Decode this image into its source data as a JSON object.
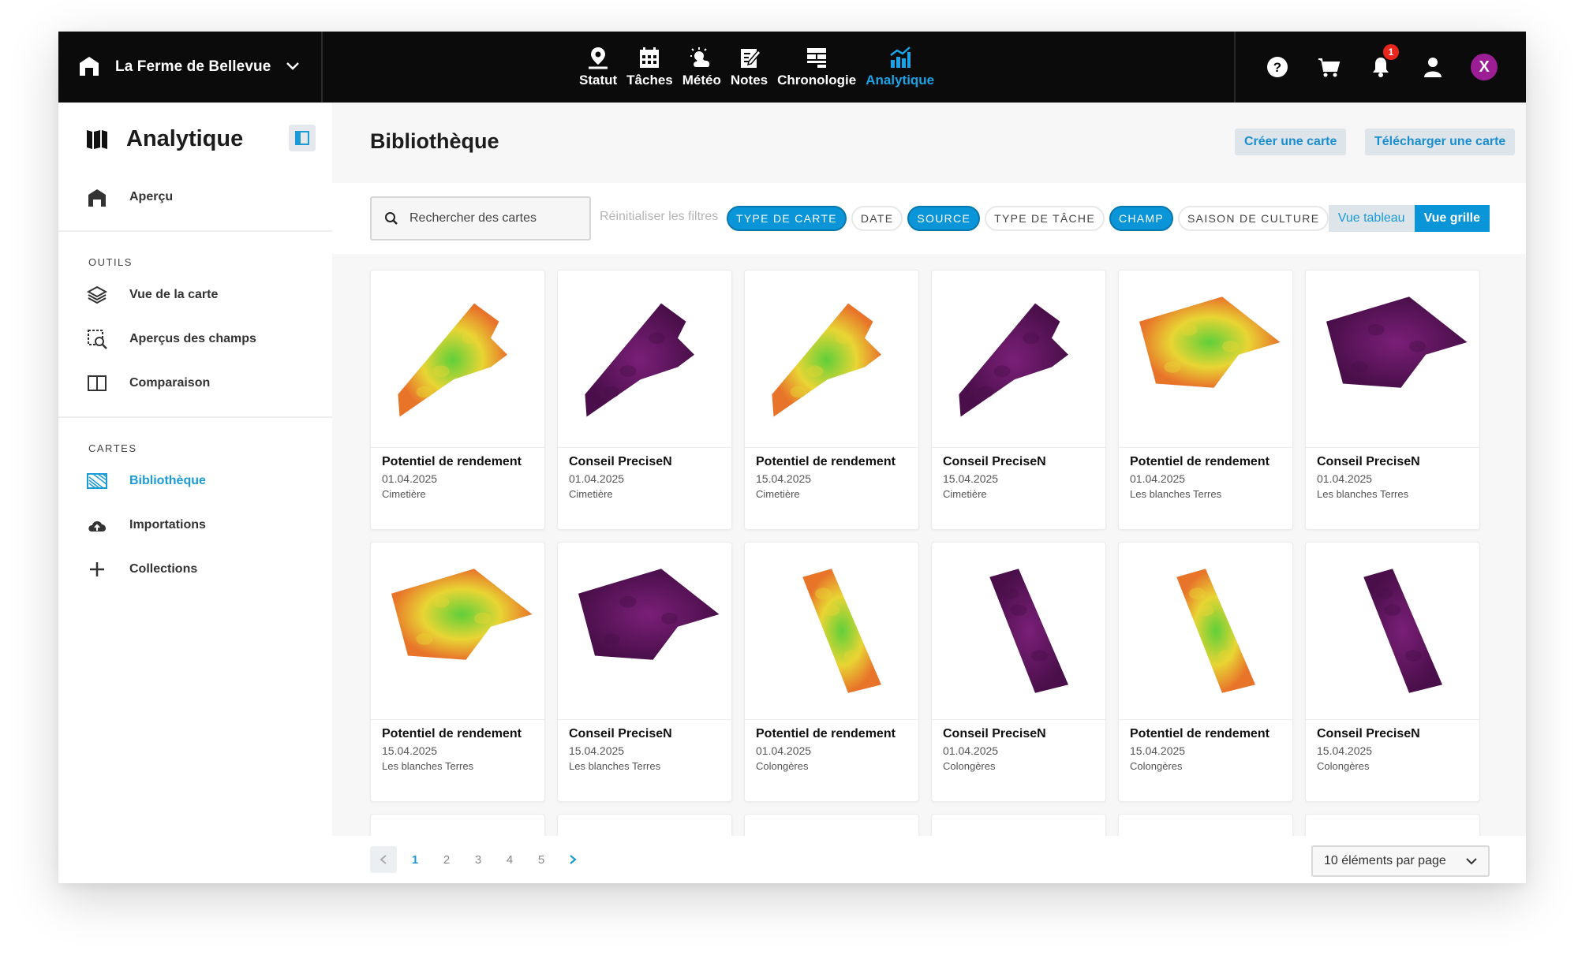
{
  "topbar": {
    "farm_name": "La Ferme de Bellevue",
    "nav": [
      {
        "label": "Statut",
        "icon": "map-pin-icon"
      },
      {
        "label": "Tâches",
        "icon": "calendar-icon"
      },
      {
        "label": "Météo",
        "icon": "weather-icon"
      },
      {
        "label": "Notes",
        "icon": "notes-icon"
      },
      {
        "label": "Chronologie",
        "icon": "timeline-icon"
      },
      {
        "label": "Analytique",
        "icon": "analytics-icon",
        "active": true
      }
    ],
    "notifications_count": "1",
    "user_initial": "X"
  },
  "sidebar": {
    "title": "Analytique",
    "overview": "Aperçu",
    "tools_section": "OUTILS",
    "tools": [
      "Vue de la carte",
      "Aperçus des champs",
      "Comparaison"
    ],
    "maps_section": "CARTES",
    "maps": [
      "Bibliothèque",
      "Importations",
      "Collections"
    ]
  },
  "main": {
    "title": "Bibliothèque",
    "create_button": "Créer une carte",
    "upload_button": "Télécharger une carte",
    "search_placeholder": "Rechercher des cartes",
    "reset_filters": "Réinitialiser les filtres",
    "chips": [
      {
        "label": "TYPE DE CARTE",
        "active": true
      },
      {
        "label": "DATE",
        "active": false
      },
      {
        "label": "SOURCE",
        "active": true
      },
      {
        "label": "TYPE DE TÂCHE",
        "active": false
      },
      {
        "label": "CHAMP",
        "active": true
      },
      {
        "label": "SAISON DE CULTURE",
        "active": false
      }
    ],
    "view_table": "Vue tableau",
    "view_grid": "Vue grille"
  },
  "cards": [
    {
      "title": "Potentiel de rendement",
      "date": "01.04.2025",
      "field": "Cimetière",
      "kind": "yield"
    },
    {
      "title": "Conseil PreciseN",
      "date": "01.04.2025",
      "field": "Cimetière",
      "kind": "precise"
    },
    {
      "title": "Potentiel de rendement",
      "date": "15.04.2025",
      "field": "Cimetière",
      "kind": "yield"
    },
    {
      "title": "Conseil PreciseN",
      "date": "15.04.2025",
      "field": "Cimetière",
      "kind": "precise"
    },
    {
      "title": "Potentiel de rendement",
      "date": "01.04.2025",
      "field": "Les blanches Terres",
      "kind": "yield"
    },
    {
      "title": "Conseil PreciseN",
      "date": "01.04.2025",
      "field": "Les blanches Terres",
      "kind": "precise"
    },
    {
      "title": "Potentiel de rendement",
      "date": "15.04.2025",
      "field": "Les blanches Terres",
      "kind": "yield"
    },
    {
      "title": "Conseil PreciseN",
      "date": "15.04.2025",
      "field": "Les blanches Terres",
      "kind": "precise"
    },
    {
      "title": "Potentiel de rendement",
      "date": "01.04.2025",
      "field": "Colongères",
      "kind": "yield"
    },
    {
      "title": "Conseil PreciseN",
      "date": "01.04.2025",
      "field": "Colongères",
      "kind": "precise"
    },
    {
      "title": "Potentiel de rendement",
      "date": "15.04.2025",
      "field": "Colongères",
      "kind": "yield"
    },
    {
      "title": "Conseil PreciseN",
      "date": "15.04.2025",
      "field": "Colongères",
      "kind": "precise"
    }
  ],
  "pagination": {
    "pages": [
      "1",
      "2",
      "3",
      "4",
      "5"
    ],
    "current": "1",
    "per_page": "10 éléments par page"
  },
  "colors": {
    "accent": "#0a95d8",
    "topbar": "#0b0b0b",
    "yield_high": "#5fcf3a",
    "yield_mid": "#e8d534",
    "yield_low": "#e8742a",
    "precise_dark": "#4a0f4a",
    "precise_light": "#7a1f78",
    "badge": "#e8261c"
  }
}
